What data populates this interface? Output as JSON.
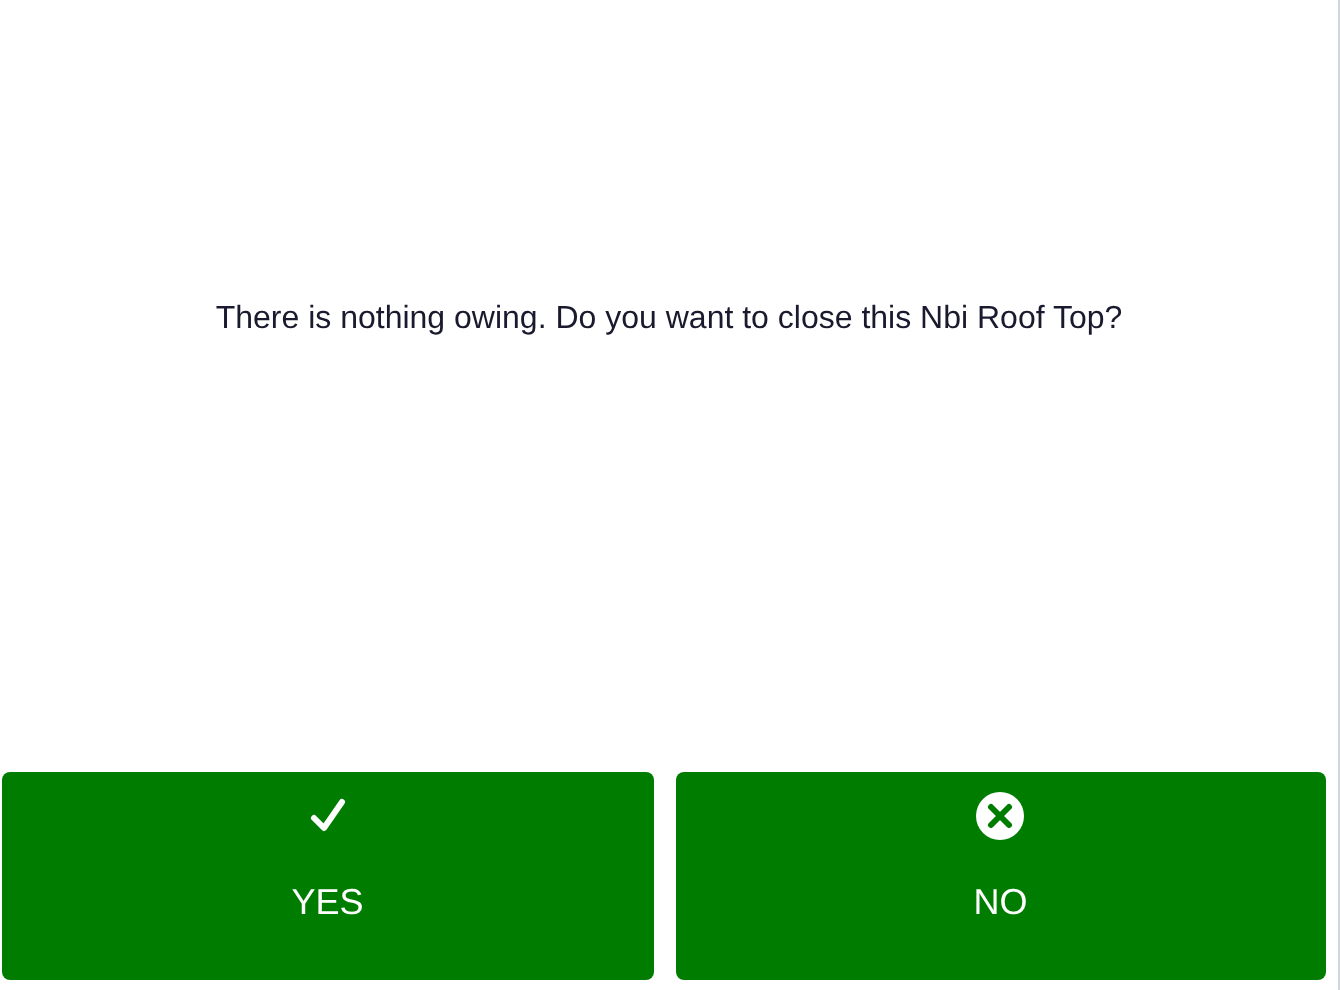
{
  "message": "There is nothing owing. Do you want to close this Nbi Roof Top?",
  "buttons": [
    {
      "label": "YES",
      "kind": "confirm"
    },
    {
      "label": "NO",
      "kind": "cancel"
    }
  ]
}
